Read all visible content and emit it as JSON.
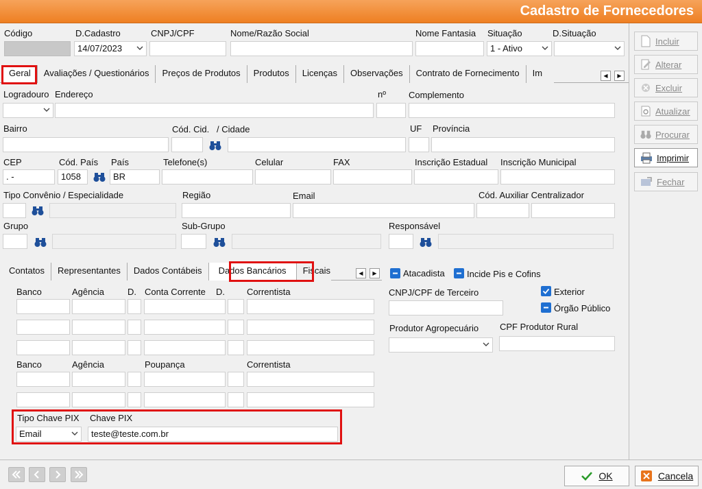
{
  "window": {
    "title": "Cadastro de Fornecedores"
  },
  "top": {
    "codigo_label": "Código",
    "dcadastro_label": "D.Cadastro",
    "dcadastro_value": "14/07/2023",
    "cnpj_label": "CNPJ/CPF",
    "nome_label": "Nome/Razão Social",
    "fantasia_label": "Nome Fantasia",
    "situacao_label": "Situação",
    "situacao_value": "1 - Ativo",
    "dsituacao_label": "D.Situação"
  },
  "tabs": [
    "Geral",
    "Avaliações / Questionários",
    "Preços de Produtos",
    "Produtos",
    "Licenças",
    "Observações",
    "Contrato de Fornecimento",
    "Im"
  ],
  "geral": {
    "logradouro": "Logradouro",
    "endereco": "Endereço",
    "numero": "nº",
    "complemento": "Complemento",
    "bairro": "Bairro",
    "cod_cid": "Cód. Cid.",
    "cidade": "/  Cidade",
    "uf": "UF",
    "provincia": "Província",
    "cep": "CEP",
    "cep_value": ".   -",
    "cod_pais": "Cód. País",
    "cod_pais_value": "1058",
    "pais": "País",
    "pais_value": "BR",
    "telefone": "Telefone(s)",
    "celular": "Celular",
    "fax": "FAX",
    "ie": "Inscrição Estadual",
    "im": "Inscrição Municipal",
    "tipo_convenio": "Tipo Convênio / Especialidade",
    "regiao": "Região",
    "email": "Email",
    "cod_aux": "Cód. Auxiliar Centralizador",
    "grupo": "Grupo",
    "subgrupo": "Sub-Grupo",
    "responsavel": "Responsável"
  },
  "subtabs": [
    "Contatos",
    "Representantes",
    "Dados Contábeis",
    "Dados Bancários",
    "Fiscais"
  ],
  "bancarios": {
    "banco": "Banco",
    "agencia": "Agência",
    "d": "D.",
    "conta": "Conta Corrente",
    "d2": "D.",
    "correntista": "Correntista",
    "banco2": "Banco",
    "agencia2": "Agência",
    "d3": "D.",
    "poupanca": "Poupança",
    "correntista2": "Correntista",
    "tipo_pix": "Tipo Chave PIX",
    "chave_pix": "Chave PIX",
    "tipo_pix_value": "Email",
    "chave_pix_value": "teste@teste.com.br"
  },
  "right": {
    "atacadista": "Atacadista",
    "incide": "Incide Pis e Cofins",
    "cnpj_terceiro": "CNPJ/CPF de Terceiro",
    "exterior": "Exterior",
    "orgao": "Órgão Público",
    "produtor": "Produtor Agropecuário",
    "cpf_rural": "CPF Produtor Rural"
  },
  "side": [
    "Incluir",
    "Alterar",
    "Excluir",
    "Atualizar",
    "Procurar",
    "Imprimir",
    "Fechar"
  ],
  "bottom": {
    "ok": "OK",
    "cancel": "Cancela"
  }
}
